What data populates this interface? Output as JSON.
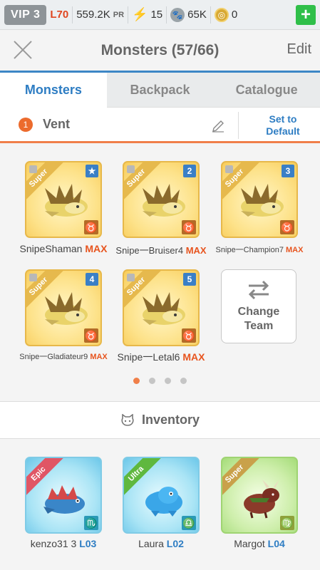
{
  "topbar": {
    "vip": "VIP 3",
    "level": "L70",
    "power": "559.2K",
    "power_unit": "PR",
    "energy": "15",
    "food": "65K",
    "coins": "0",
    "add": "+"
  },
  "header": {
    "title": "Monsters (57/66)",
    "edit": "Edit"
  },
  "tabs": [
    {
      "label": "Monsters",
      "active": true
    },
    {
      "label": "Backpack"
    },
    {
      "label": "Catalogue"
    }
  ],
  "team": {
    "number": "1",
    "name": "Vent",
    "set_default": "Set to Default"
  },
  "team_monsters": [
    {
      "name": "SnipeShaman",
      "tag": "MAX",
      "rarity": "Super",
      "slot": "★",
      "zodiac": "♉"
    },
    {
      "name": "Snipe一Bruiser4",
      "tag": "MAX",
      "rarity": "Super",
      "slot": "2",
      "zodiac": "♉"
    },
    {
      "name": "Snipe一Champion7",
      "tag": "MAX",
      "rarity": "Super",
      "slot": "3",
      "zodiac": "♉"
    },
    {
      "name": "Snipe一Gladiateur9",
      "tag": "MAX",
      "rarity": "Super",
      "slot": "4",
      "zodiac": "♉"
    },
    {
      "name": "Snipe一Letal6",
      "tag": "MAX",
      "rarity": "Super",
      "slot": "5",
      "zodiac": "♉"
    }
  ],
  "change_team": "Change Team",
  "pager": {
    "pages": 4,
    "current": 1
  },
  "inventory": {
    "title": "Inventory",
    "items": [
      {
        "name": "kenzo31 3",
        "level": "L03",
        "rarity": "Epic",
        "zodiac": "♏"
      },
      {
        "name": "Laura",
        "level": "L02",
        "rarity": "Ultra",
        "zodiac": "♎"
      },
      {
        "name": "Margot",
        "level": "L04",
        "rarity": "Super",
        "zodiac": "♍"
      }
    ]
  },
  "colors": {
    "accent": "#2e7dc3",
    "orange": "#f07f49",
    "max": "#e7541e"
  }
}
